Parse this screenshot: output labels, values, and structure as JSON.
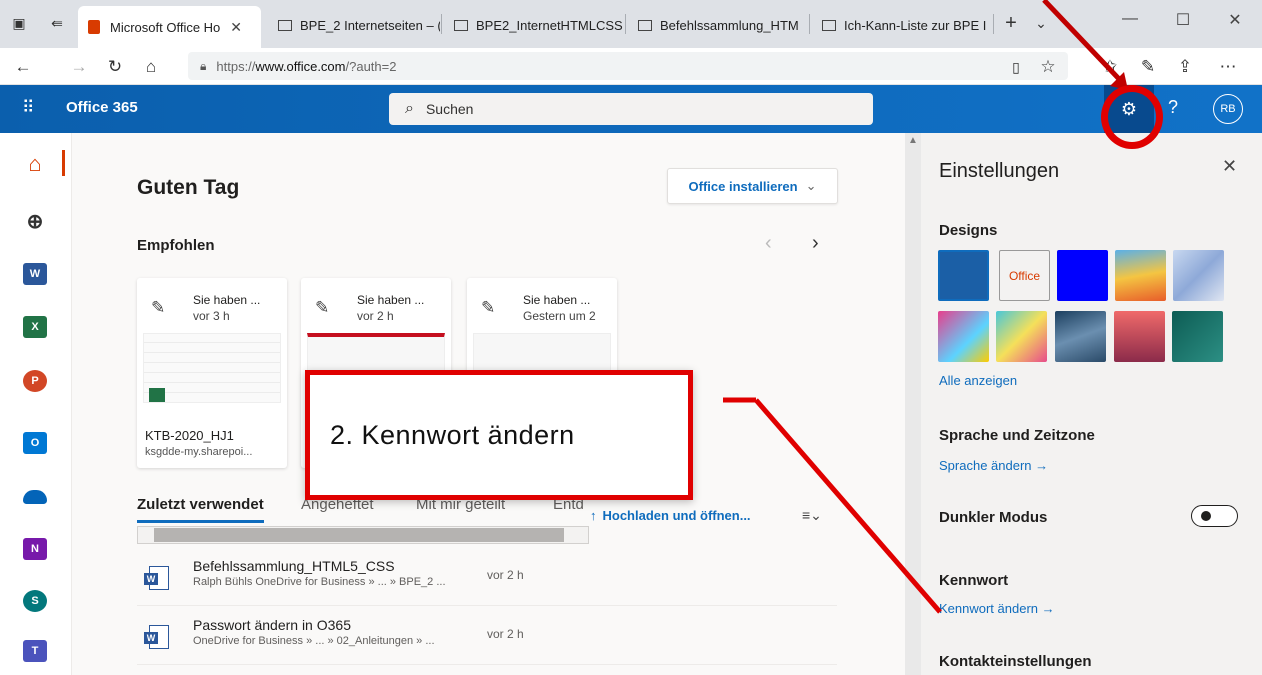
{
  "browser": {
    "tabs": [
      {
        "label": "Microsoft Office Ho"
      },
      {
        "label": "BPE_2 Internetseiten – ("
      },
      {
        "label": "BPE2_InternetHTMLCSS"
      },
      {
        "label": "Befehlssammlung_HTM"
      },
      {
        "label": "Ich-Kann-Liste zur BPE I"
      }
    ],
    "url_prefix": "https://",
    "url_host": "www.office.com",
    "url_rest": "/?auth=2"
  },
  "header": {
    "brand": "Office 365",
    "search_placeholder": "Suchen",
    "avatar_initials": "RB"
  },
  "main": {
    "greeting": "Guten Tag",
    "install_button": "Office installieren",
    "recommended_title": "Empfohlen",
    "cards": [
      {
        "line1": "Sie haben ...",
        "line2": "vor 3 h",
        "file_name": "KTB-2020_HJ1",
        "file_source": "ksgdde-my.sharepoi..."
      },
      {
        "line1": "Sie haben ...",
        "line2": "vor 2 h",
        "file_name": "",
        "file_source": ""
      },
      {
        "line1": "Sie haben ...",
        "line2": "Gestern um 2",
        "file_name": "",
        "file_source": ""
      }
    ],
    "list_tabs": [
      {
        "label": "Zuletzt verwendet"
      },
      {
        "label": "Angeheftet"
      },
      {
        "label": "Mit mir geteilt"
      },
      {
        "label": "Entd"
      }
    ],
    "upload_label": "Hochladen und öffnen...",
    "files": [
      {
        "name": "Befehlssammlung_HTML5_CSS",
        "path": "Ralph Bühls OneDrive for Business » ... » BPE_2 ...",
        "time": "vor 2 h"
      },
      {
        "name": "Passwort ändern in O365",
        "path": "OneDrive for Business » ... » 02_Anleitungen » ...",
        "time": "vor 2 h"
      }
    ]
  },
  "settings": {
    "title": "Einstellungen",
    "designs_title": "Designs",
    "office_theme_label": "Office",
    "show_all": "Alle anzeigen",
    "language_title": "Sprache und Zeitzone",
    "language_link": "Sprache ändern →",
    "dark_mode_title": "Dunkler Modus",
    "dark_mode_on": false,
    "password_title": "Kennwort",
    "password_link": "Kennwort ändern →",
    "contact_title": "Kontakteinstellungen"
  },
  "annotation": {
    "callout_text": "2. Kennwort ändern",
    "accent_color": "#e00000"
  }
}
